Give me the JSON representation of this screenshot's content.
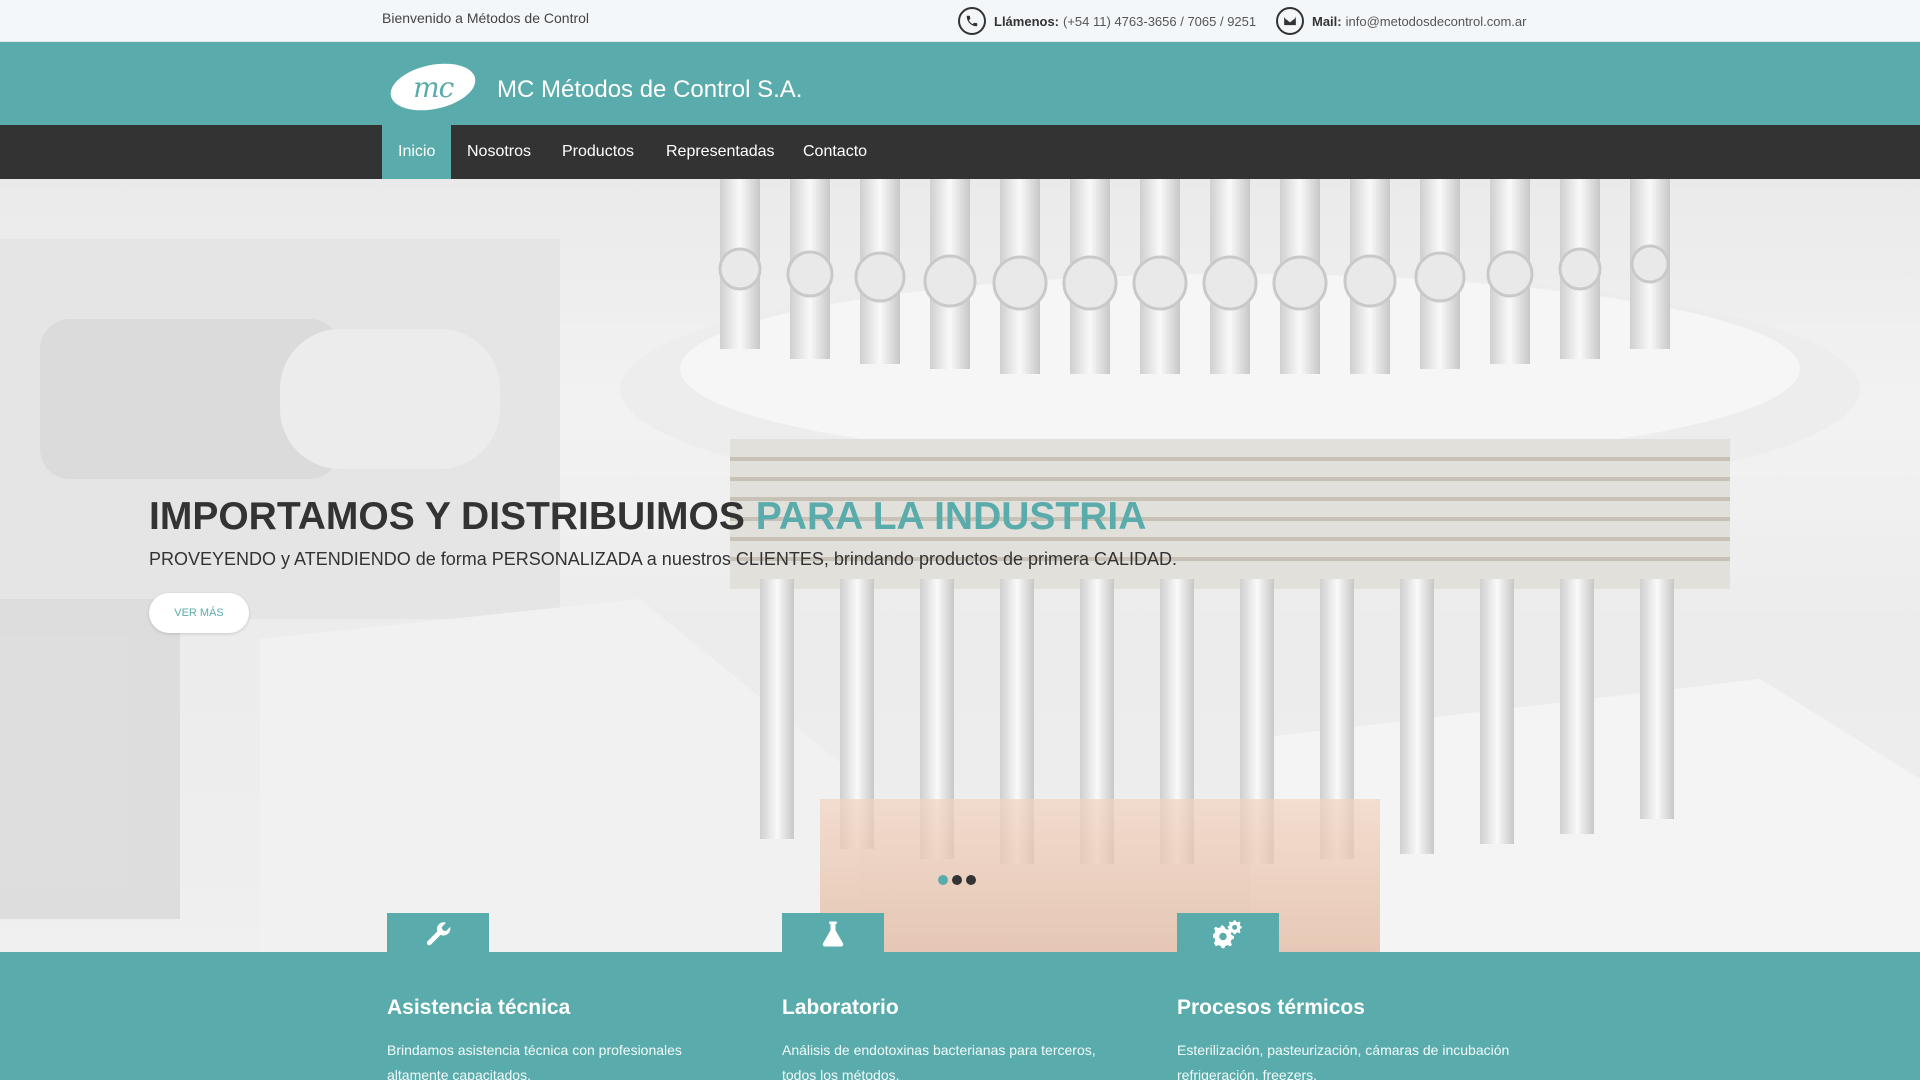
{
  "topbar": {
    "welcome": "Bienvenido a Métodos de Control",
    "phone_label": "Llámenos:",
    "phone_value": "(+54 11) 4763-3656 / 7065 / 9251",
    "mail_label": "Mail:",
    "mail_value": "info@metodosdecontrol.com.ar",
    "phone_icon": "phone-icon",
    "mail_icon": "envelope-icon"
  },
  "brand": {
    "logo_text": "mc",
    "name": "MC Métodos de Control S.A."
  },
  "nav": {
    "items": [
      {
        "label": "Inicio",
        "active": true
      },
      {
        "label": "Nosotros",
        "active": false
      },
      {
        "label": "Productos",
        "active": false
      },
      {
        "label": "Representadas",
        "active": false
      },
      {
        "label": "Contacto",
        "active": false
      }
    ]
  },
  "hero": {
    "title_main": "IMPORTAMOS Y DISTRIBUIMOS",
    "title_accent": "PARA LA INDUSTRIA",
    "subtitle": "PROVEYENDO y ATENDIENDO de forma PERSONALIZADA a nuestros CLIENTES, brindando productos de primera CALIDAD.",
    "button_label": "VER MÁS",
    "slide_count": 3,
    "active_slide": 1
  },
  "services": [
    {
      "icon": "wrench-icon",
      "title": "Asistencia técnica",
      "text": "Brindamos asistencia técnica con profesionales altamente capacitados."
    },
    {
      "icon": "flask-icon",
      "title": "Laboratorio",
      "text": "Análisis de endotoxinas bacterianas para terceros, todos los métodos."
    },
    {
      "icon": "gears-icon",
      "title": "Procesos térmicos",
      "text": "Esterilización, pasteurización, cámaras de incubación refrigeración, freezers."
    }
  ],
  "colors": {
    "accent": "#5aabab",
    "nav_bg": "#333333",
    "topbar_bg": "#f4f7f9"
  }
}
